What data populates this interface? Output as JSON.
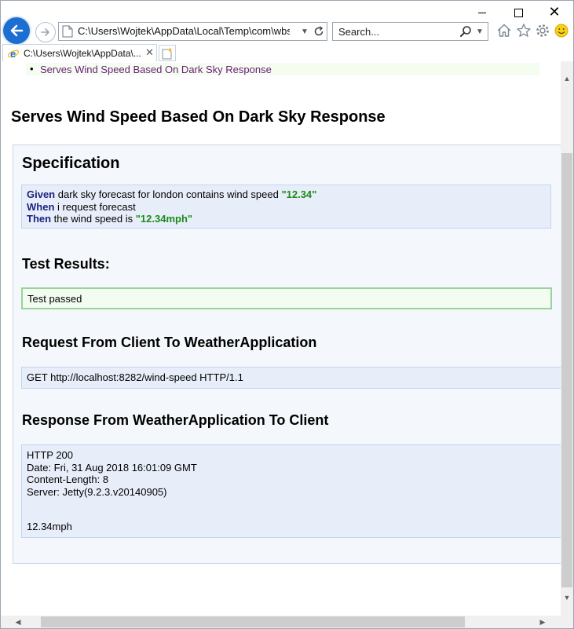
{
  "browser": {
    "address": "C:\\Users\\Wojtek\\AppData\\Local\\Temp\\com\\wbsoftw",
    "search_placeholder": "Search...",
    "tab_title": "C:\\Users\\Wojtek\\AppData\\...",
    "icons": [
      "back-arrow-icon",
      "forward-arrow-icon",
      "refresh-icon",
      "search-icon",
      "home-icon",
      "favorites-star-icon",
      "settings-gear-icon",
      "smiley-feedback-icon",
      "ie-logo-icon",
      "new-tab-icon",
      "close-icon"
    ],
    "accent_color": "#1c6fd1"
  },
  "toc": {
    "bullet": "•",
    "link": "Serves Wind Speed Based On Dark Sky Response"
  },
  "page": {
    "title": "Serves Wind Speed Based On Dark Sky Response"
  },
  "specification": {
    "title": "Specification",
    "lines": [
      {
        "keyword": "Given",
        "text": " dark sky forecast for london contains wind speed ",
        "value": "\"12.34\""
      },
      {
        "keyword": "When",
        "text": " i request forecast",
        "value": ""
      },
      {
        "keyword": "Then",
        "text": " the wind speed is ",
        "value": "\"12.34mph\""
      }
    ]
  },
  "results": {
    "title": "Test Results:",
    "status": "Test passed",
    "status_color": "#9ad39a"
  },
  "request": {
    "title": "Request From Client To WeatherApplication",
    "line": "GET http://localhost:8282/wind-speed HTTP/1.1"
  },
  "response": {
    "title": "Response From WeatherApplication To Client",
    "status": "HTTP 200",
    "date": "Date: Fri, 31 Aug 2018 16:01:09 GMT",
    "content_length": "Content-Length: 8",
    "server": "Server: Jetty(9.2.3.v20140905)",
    "body": "12.34mph"
  }
}
